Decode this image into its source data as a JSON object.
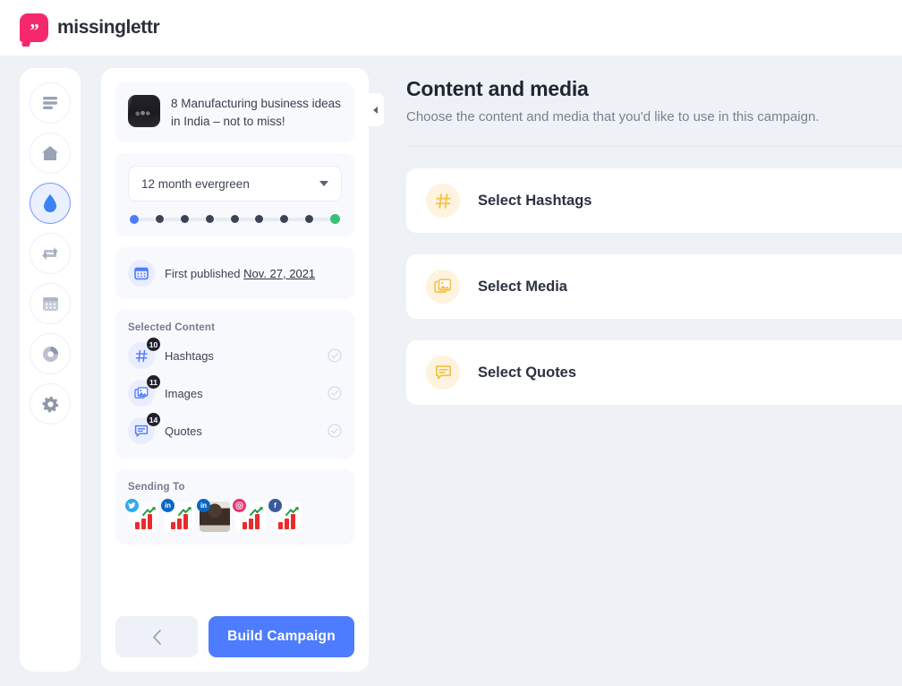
{
  "brand": {
    "name": "missinglettr",
    "logo_icon": "quote-bubble-icon",
    "accent": "#f5286e"
  },
  "rail": {
    "items": [
      {
        "name": "menu",
        "icon": "hamburger-menu-icon",
        "active": false
      },
      {
        "name": "home",
        "icon": "home-icon",
        "active": false
      },
      {
        "name": "drip",
        "icon": "water-drop-icon",
        "active": true
      },
      {
        "name": "curate",
        "icon": "repeat-icon",
        "active": false
      },
      {
        "name": "calendar",
        "icon": "calendar-icon",
        "active": false
      },
      {
        "name": "analytics",
        "icon": "pie-chart-icon",
        "active": false
      },
      {
        "name": "settings",
        "icon": "gear-icon",
        "active": false
      }
    ]
  },
  "panel": {
    "post": {
      "title": "8 Manufacturing business ideas in India – not to miss!",
      "thumbnail_icon": "post-thumbnail"
    },
    "campaign_type": {
      "value": "12 month evergreen",
      "caret_icon": "chevron-down-icon"
    },
    "progress": {
      "total_steps": 9,
      "first_color": "#4d7cfe",
      "mid_color": "#3b4354",
      "last_color": "#3cbf78"
    },
    "published": {
      "icon": "calendar-icon",
      "label": "First published",
      "date": "Nov. 27, 2021"
    },
    "selected_content": {
      "label": "Selected Content",
      "items": [
        {
          "label": "Hashtags",
          "count": "10",
          "icon": "hashtag-icon",
          "status_icon": "check-circle-icon"
        },
        {
          "label": "Images",
          "count": "11",
          "icon": "images-icon",
          "status_icon": "check-circle-icon"
        },
        {
          "label": "Quotes",
          "count": "14",
          "icon": "quote-bubble-icon",
          "status_icon": "check-circle-icon"
        }
      ]
    },
    "sending_to": {
      "label": "Sending To",
      "accounts": [
        {
          "network": "twitter",
          "badge": "t",
          "avatar": "chart-logo"
        },
        {
          "network": "linkedin",
          "badge": "in",
          "avatar": "chart-logo"
        },
        {
          "network": "linkedin",
          "badge": "in",
          "avatar": "photo"
        },
        {
          "network": "instagram",
          "badge": "◉",
          "avatar": "chart-logo"
        },
        {
          "network": "facebook",
          "badge": "f",
          "avatar": "chart-logo"
        }
      ]
    },
    "footer": {
      "back_icon": "chevron-left-icon",
      "build_label": "Build Campaign",
      "build_color": "#4d7cfe"
    },
    "collapse_icon": "chevron-left-icon"
  },
  "main": {
    "title": "Content and media",
    "subtitle": "Choose the content and media that you'd like to use in this campaign.",
    "cards": [
      {
        "label": "Select Hashtags",
        "icon": "hashtag-icon"
      },
      {
        "label": "Select Media",
        "icon": "images-icon"
      },
      {
        "label": "Select Quotes",
        "icon": "quote-bubble-icon"
      }
    ],
    "icon_bg": "#fdf3de",
    "icon_color": "#f3c34d"
  }
}
